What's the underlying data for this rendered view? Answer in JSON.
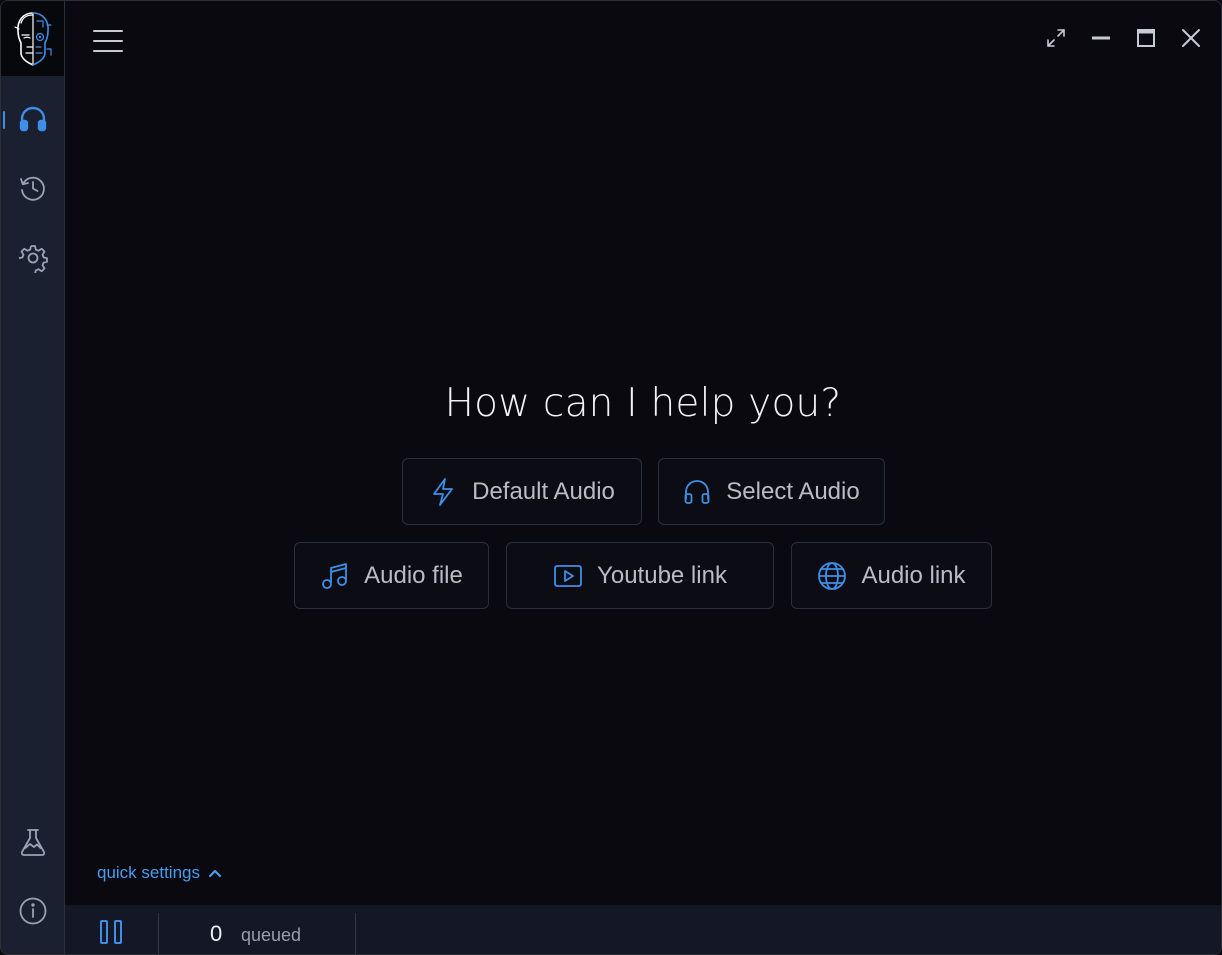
{
  "main": {
    "heading": "How can I help you?",
    "actions_row1": [
      {
        "label": "Default Audio",
        "icon": "lightning-icon"
      },
      {
        "label": "Select Audio",
        "icon": "headphones-icon"
      }
    ],
    "actions_row2": [
      {
        "label": "Audio file",
        "icon": "music-note-icon"
      },
      {
        "label": "Youtube link",
        "icon": "play-video-icon"
      },
      {
        "label": "Audio link",
        "icon": "globe-icon"
      }
    ]
  },
  "quick_settings": {
    "label": "quick settings"
  },
  "statusbar": {
    "queue_count": "0",
    "queue_label": "queued"
  },
  "sidebar": {
    "items": [
      {
        "icon": "headphones-icon",
        "active": true
      },
      {
        "icon": "history-icon"
      },
      {
        "icon": "gear-icon"
      },
      {
        "icon": "flask-icon"
      },
      {
        "icon": "info-icon"
      }
    ]
  },
  "colors": {
    "accent": "#3e8fe8",
    "background": "#09090f",
    "sidebar": "#1b2030"
  }
}
